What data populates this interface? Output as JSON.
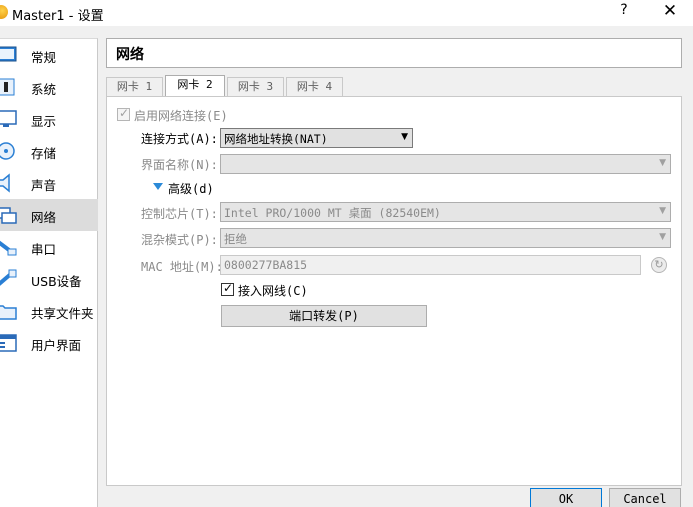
{
  "window": {
    "title": "Master1 - 设置",
    "help": "?",
    "close": "✕"
  },
  "sidebar": {
    "items": [
      {
        "label": "常规",
        "icon": "general-settings-icon"
      },
      {
        "label": "系统",
        "icon": "system-chip-icon"
      },
      {
        "label": "显示",
        "icon": "display-monitor-icon"
      },
      {
        "label": "存储",
        "icon": "storage-disk-icon"
      },
      {
        "label": "声音",
        "icon": "speaker-icon"
      },
      {
        "label": "网络",
        "icon": "network-icon",
        "active": true
      },
      {
        "label": "串口",
        "icon": "serial-port-icon"
      },
      {
        "label": "USB设备",
        "icon": "usb-icon"
      },
      {
        "label": "共享文件夹",
        "icon": "shared-folder-icon"
      },
      {
        "label": "用户界面",
        "icon": "user-interface-icon"
      }
    ]
  },
  "page": {
    "title": "网络"
  },
  "tabs": [
    {
      "label": "网卡 1"
    },
    {
      "label": "网卡 2",
      "active": true
    },
    {
      "label": "网卡 3"
    },
    {
      "label": "网卡 4"
    }
  ],
  "form": {
    "enable_adapter": {
      "label": "启用网络连接(E)",
      "checked": true,
      "enabled": false
    },
    "attached_to": {
      "label": "连接方式(A):",
      "value": "网络地址转换(NAT)"
    },
    "name": {
      "label": "界面名称(N):",
      "value": ""
    },
    "advanced": {
      "label": "高级(d)"
    },
    "adapter_type": {
      "label": "控制芯片(T):",
      "value": "Intel PRO/1000 MT 桌面 (82540EM)"
    },
    "promiscuous": {
      "label": "混杂模式(P):",
      "value": "拒绝"
    },
    "mac": {
      "label": "MAC 地址(M):",
      "value": "0800277BA815"
    },
    "cable": {
      "label": "接入网线(C)",
      "checked": true
    },
    "port_forwarding": {
      "label": "端口转发(P)"
    }
  },
  "buttons": {
    "ok": "OK",
    "cancel": "Cancel"
  },
  "colors": {
    "accent": "#0078d7",
    "advanced_triangle": "#2b8ad8",
    "active_sidebar": "#dcdcdc"
  }
}
